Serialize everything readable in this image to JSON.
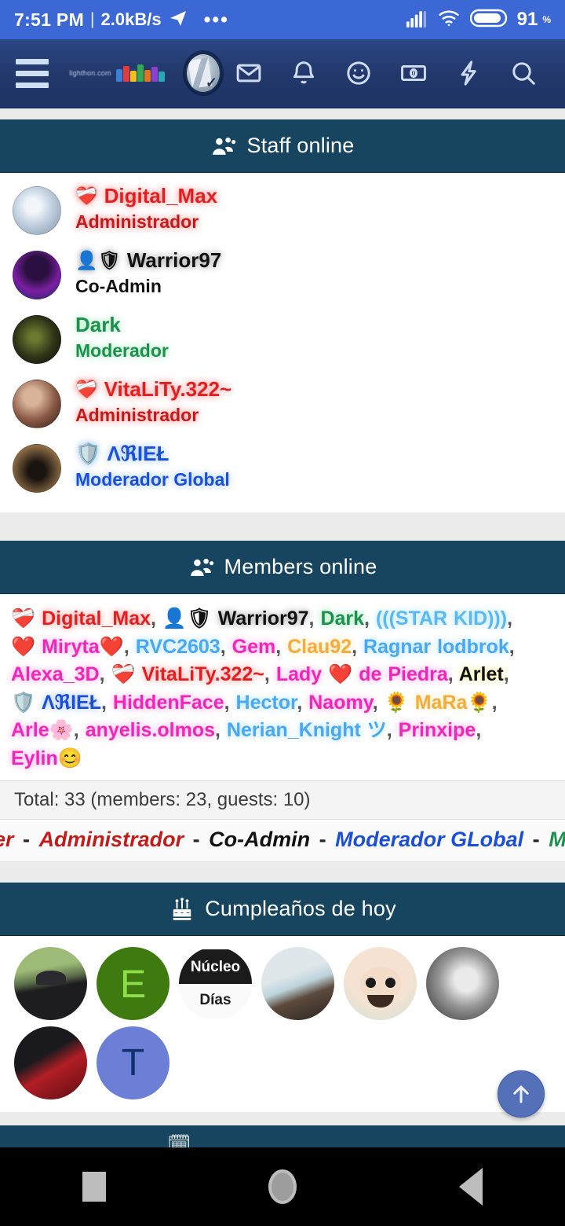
{
  "status_bar": {
    "time": "7:51 PM",
    "separator": "|",
    "network_speed": "2.0kB/s",
    "telegram_icon": "telegram-icon",
    "overflow_dots": "•••",
    "signal_icon": "signal-bars-icon",
    "wifi_icon": "wifi-icon",
    "battery_level": "91",
    "battery_unit": "%",
    "background": "#3b68d4"
  },
  "navbar": {
    "menu_icon": "hamburger-menu-icon",
    "brand_text": "lighthon.com",
    "avatar_icon": "user-avatar-icon",
    "icons": [
      {
        "name": "inbox-icon",
        "label": "Inbox"
      },
      {
        "name": "bell-icon",
        "label": "Alerts"
      },
      {
        "name": "smiley-icon",
        "label": "Reactions"
      },
      {
        "name": "money-icon",
        "label": "Credits"
      },
      {
        "name": "lightning-icon",
        "label": "Whats new"
      },
      {
        "name": "search-icon",
        "label": "Search"
      }
    ],
    "background": "#22376a"
  },
  "staff_block": {
    "header_icon": "users-group-icon",
    "header_title": "Staff online",
    "header_background": "#174560",
    "members": [
      {
        "badge": "heartbeat-icon",
        "name": "Digital_Max",
        "name_color": "#e02020",
        "title": "Administrador",
        "title_color": "#c11b1b",
        "avatar_style": "light"
      },
      {
        "badge": "shield-user-icon",
        "name": "Warrior97",
        "name_color": "#111111",
        "title": "Co-Admin",
        "title_color": "#111111",
        "avatar_style": "neon"
      },
      {
        "badge": "",
        "name": "Dark",
        "name_color": "#1f8f4e",
        "title": "Moderador",
        "title_color": "#1f8f4e",
        "avatar_style": "dark"
      },
      {
        "badge": "heartbeat-icon",
        "name": "VitaLiTy.322~",
        "name_color": "#e02020",
        "title": "Administrador",
        "title_color": "#c11b1b",
        "avatar_style": "photo"
      },
      {
        "badge": "shield-icon",
        "name": "ΛℜIEŁ",
        "name_color": "#1b4fd8",
        "title": "Moderador Global",
        "title_color": "#1b4fd8",
        "avatar_style": "brown"
      }
    ]
  },
  "members_block": {
    "header_icon": "users-group-icon",
    "header_title": "Members online",
    "header_background": "#174560",
    "online": [
      {
        "badge": "heartbeat-icon",
        "name": "Digital_Max",
        "color": "#e02020",
        "glow": "rgba(255,120,120,.9)"
      },
      {
        "badge": "shield-user-icon",
        "name": "Warrior97",
        "color": "#111111",
        "glow": "rgba(0,0,0,.45)"
      },
      {
        "badge": "",
        "name": "Dark",
        "color": "#1f8f4e",
        "glow": "rgba(120,230,160,.9)"
      },
      {
        "badge": "",
        "name": "(((STAR KID)))",
        "color": "#5bb8f2",
        "glow": "rgba(150,220,255,.9)"
      },
      {
        "badge": "heart-icon",
        "name": "Miryta",
        "suffix": "heart-icon",
        "color": "#ef26b8",
        "glow": "rgba(255,140,220,.9)"
      },
      {
        "badge": "",
        "name": "RVC2603",
        "color": "#4aa8f0",
        "glow": "rgba(150,215,255,.9)"
      },
      {
        "badge": "",
        "name": "Gem",
        "color": "#ef26b8",
        "glow": "rgba(255,140,220,.9)"
      },
      {
        "badge": "",
        "name": "Clau92",
        "color": "#f3ac3c",
        "glow": "rgba(255,220,150,.95)"
      },
      {
        "badge": "",
        "name": "Ragnar lodbrok",
        "color": "#4aa8f0",
        "glow": "rgba(150,215,255,.9)"
      },
      {
        "badge": "",
        "name": "Alexa_3D",
        "color": "#ef26b8",
        "glow": "rgba(255,140,220,.9)"
      },
      {
        "badge": "heartbeat-icon",
        "name": "VitaLiTy.322~",
        "color": "#e02020",
        "glow": "rgba(255,120,120,.9)"
      },
      {
        "badge": "",
        "name": "Lady",
        "mid": "heart-icon",
        "name2": "de Piedra",
        "color": "#ef26b8",
        "glow": "rgba(255,140,220,.9)"
      },
      {
        "badge": "",
        "name": "Arlet",
        "color": "#111111",
        "glow": "rgba(255,240,120,.95)"
      },
      {
        "badge": "shield-icon",
        "name": "ΛℜIEŁ",
        "color": "#1b4fd8",
        "glow": "rgba(140,180,255,.95)"
      },
      {
        "badge": "",
        "name": "HiddenFace",
        "color": "#ef26b8",
        "glow": "rgba(255,140,220,.9)"
      },
      {
        "badge": "",
        "name": "Hector",
        "color": "#4aa8f0",
        "glow": "rgba(150,215,255,.9)"
      },
      {
        "badge": "",
        "name": "Naomy",
        "color": "#ef26b8",
        "glow": "rgba(255,140,220,.9)"
      },
      {
        "badge": "sunflower-icon",
        "name": "MaRa",
        "suffix": "sunflower-icon",
        "color": "#f3ac3c",
        "glow": "rgba(255,225,160,.95)"
      },
      {
        "badge": "",
        "name": "Arle",
        "suffix": "blossom-icon",
        "color": "#ef26b8",
        "glow": "rgba(255,140,220,.9)"
      },
      {
        "badge": "",
        "name": "anyelis.olmos",
        "color": "#ef26b8",
        "glow": "rgba(255,140,220,.9)"
      },
      {
        "badge": "",
        "name": "Nerian_Knight ツ",
        "color": "#4aa8f0",
        "glow": "rgba(150,215,255,.9)"
      },
      {
        "badge": "",
        "name": "Prinxipe",
        "color": "#ef26b8",
        "glow": "rgba(255,140,220,.9)"
      },
      {
        "badge": "",
        "name": "Eylin",
        "suffix": "smile-emoji-icon",
        "color": "#ef26b8",
        "glow": "rgba(255,140,220,.9)"
      }
    ],
    "separator": ", ",
    "total_text": "Total: 33 (members: 23, guests: 10)",
    "legend": [
      {
        "text": "ster",
        "color": "#c11b1b"
      },
      {
        "text": "-",
        "color": "#222222"
      },
      {
        "text": "Administrador",
        "color": "#c11b1b"
      },
      {
        "text": "-",
        "color": "#222222"
      },
      {
        "text": "Co-Admin",
        "color": "#111111"
      },
      {
        "text": "-",
        "color": "#222222"
      },
      {
        "text": "Moderador GLobal",
        "color": "#1b4fd8"
      },
      {
        "text": "-",
        "color": "#222222"
      },
      {
        "text": "Mod",
        "color": "#1f8f4e"
      }
    ]
  },
  "birthdays_block": {
    "header_icon": "birthday-cake-icon",
    "header_title": "Cumpleaños de hoy",
    "header_background": "#174560",
    "avatars": [
      {
        "name": "birthday-avatar-1",
        "kind": "photo-man-sunglasses",
        "letter": ""
      },
      {
        "name": "birthday-avatar-2",
        "kind": "letter",
        "letter": "E",
        "bg": "#3f7a10",
        "fg": "#8ede4a"
      },
      {
        "name": "birthday-avatar-3",
        "kind": "text-card",
        "letter": "",
        "line1": "Núcleo",
        "line2": "Días"
      },
      {
        "name": "birthday-avatar-4",
        "kind": "photo-person",
        "letter": ""
      },
      {
        "name": "birthday-avatar-5",
        "kind": "memoji-bearded",
        "letter": ""
      },
      {
        "name": "birthday-avatar-6",
        "kind": "photo-grayscale",
        "letter": ""
      },
      {
        "name": "birthday-avatar-7",
        "kind": "anime-red",
        "letter": ""
      },
      {
        "name": "birthday-avatar-8",
        "kind": "letter",
        "letter": "T",
        "bg": "#6b7fd7",
        "fg": "#13306e"
      }
    ]
  },
  "scroll_top_button": {
    "icon": "arrow-up-icon",
    "label": "Scroll to top"
  },
  "android_nav": {
    "recents_icon": "square-recents-icon",
    "home_icon": "circle-home-icon",
    "back_icon": "triangle-back-icon"
  }
}
